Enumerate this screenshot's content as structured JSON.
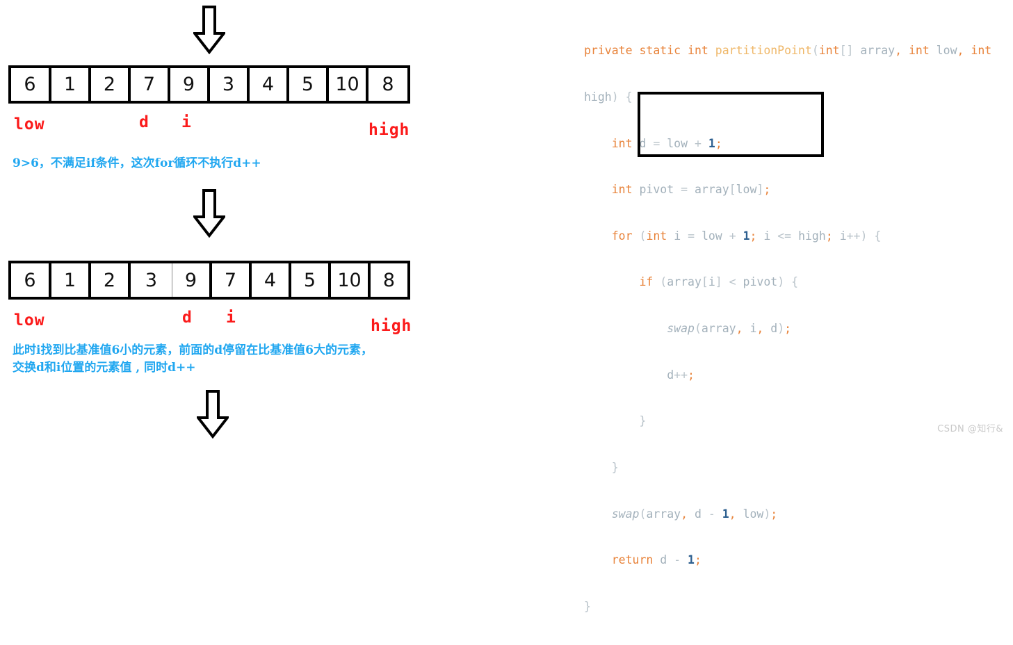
{
  "page": {
    "watermark": "CSDN @知行&"
  },
  "colors": {
    "pointer_red": "#fb1b1b",
    "note_blue": "#21a7f0",
    "code_keyword": "#e8833a",
    "code_method": "#efb768",
    "code_variable": "#a3b1bb",
    "code_number": "#2d5f8f",
    "box_border": "#000000",
    "watermark_gray": "#c9c9c9"
  },
  "arrows": [
    {
      "name": "arrow-top",
      "glyph": "down-arrow"
    },
    {
      "name": "arrow-middle",
      "glyph": "down-arrow"
    },
    {
      "name": "arrow-bottom",
      "glyph": "down-arrow"
    }
  ],
  "steps": [
    {
      "id": "step-1",
      "array": {
        "values": [
          "6",
          "1",
          "2",
          "7",
          "9",
          "3",
          "4",
          "5",
          "10",
          "8"
        ]
      },
      "pointers": [
        {
          "label": "low",
          "index": 0
        },
        {
          "label": "d",
          "index": 3
        },
        {
          "label": "i",
          "index": 4
        },
        {
          "label": "high",
          "index": 9
        }
      ],
      "note_lines": [
        "9>6，不满足if条件，这次for循环不执行d++"
      ]
    },
    {
      "id": "step-2",
      "array": {
        "values": [
          "6",
          "1",
          "2",
          "3",
          "9",
          "7",
          "4",
          "5",
          "10",
          "8"
        ]
      },
      "pointers": [
        {
          "label": "low",
          "index": 0
        },
        {
          "label": "d",
          "index": 4
        },
        {
          "label": "i",
          "index": 5
        },
        {
          "label": "high",
          "index": 9
        }
      ],
      "note_lines": [
        "此时i找到比基准值6小的元素，前面的d停留在比基准值6大的元素，",
        "交换d和i位置的元素值 , 同时d++"
      ]
    }
  ],
  "code": {
    "language": "java",
    "lines": [
      "private static int partitionPoint(int[] array, int low, int",
      "high) {",
      "    int d = low + 1;",
      "    int pivot = array[low];",
      "    for (int i = low + 1; i <= high; i++) {",
      "        if (array[i] < pivot) {",
      "            swap(array, i, d);",
      "            d++;",
      "        }",
      "    }",
      "    swap(array, d - 1, low);",
      "    return d - 1;",
      "}"
    ],
    "highlight_box": {
      "name": "if-block-highlight",
      "first_line": "        if (array[i] < pivot) {",
      "last_line": "        }"
    }
  }
}
